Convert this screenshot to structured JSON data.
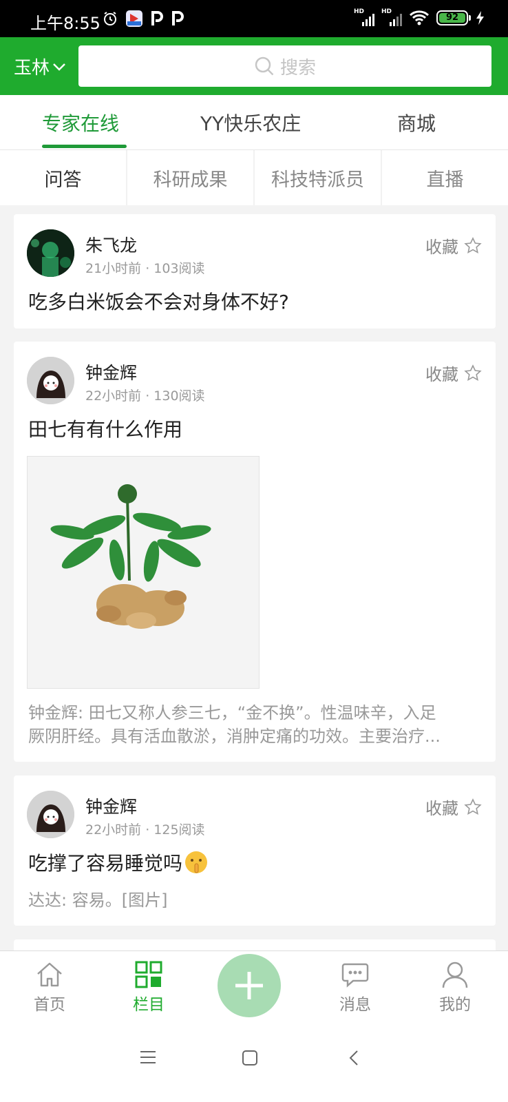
{
  "status_bar": {
    "time": "上午8:55",
    "battery": "92",
    "network_label": "HD"
  },
  "header": {
    "city": "玉林",
    "search_placeholder": "搜索"
  },
  "tabs": [
    {
      "label": "专家在线",
      "active": true
    },
    {
      "label": "YY快乐农庄",
      "active": false
    },
    {
      "label": "商城",
      "active": false
    }
  ],
  "subtabs": [
    {
      "label": "问答",
      "active": true
    },
    {
      "label": "科研成果",
      "active": false
    },
    {
      "label": "科技特派员",
      "active": false
    },
    {
      "label": "直播",
      "active": false
    }
  ],
  "collect_label": "收藏",
  "posts": [
    {
      "author": "朱飞龙",
      "meta": "21小时前 · 103阅读",
      "title": "吃多白米饭会不会对身体不好?"
    },
    {
      "author": "钟金辉",
      "meta": "22小时前 · 130阅读",
      "title": "田七有有什么作用",
      "preview_line1": "钟金辉: 田七又称人参三七，“金不换”。性温味辛，入足",
      "preview_line2": "厥阴肝经。具有活血散淤，消肿定痛的功效。主要治疗..."
    },
    {
      "author": "钟金辉",
      "meta": "22小时前 · 125阅读",
      "title": "吃撑了容易睡觉吗",
      "preview_line1": "达达: 容易。[图片]"
    }
  ],
  "bottom_nav": [
    {
      "label": "首页",
      "icon": "home-icon",
      "active": false
    },
    {
      "label": "栏目",
      "icon": "grid-icon",
      "active": true
    },
    {
      "label": "",
      "icon": "plus-icon",
      "active": false
    },
    {
      "label": "消息",
      "icon": "message-icon",
      "active": false
    },
    {
      "label": "我的",
      "icon": "user-icon",
      "active": false
    }
  ],
  "colors": {
    "brand_green": "#1fab2e",
    "tab_active": "#1f9a38",
    "fab": "#a8dcb3"
  }
}
